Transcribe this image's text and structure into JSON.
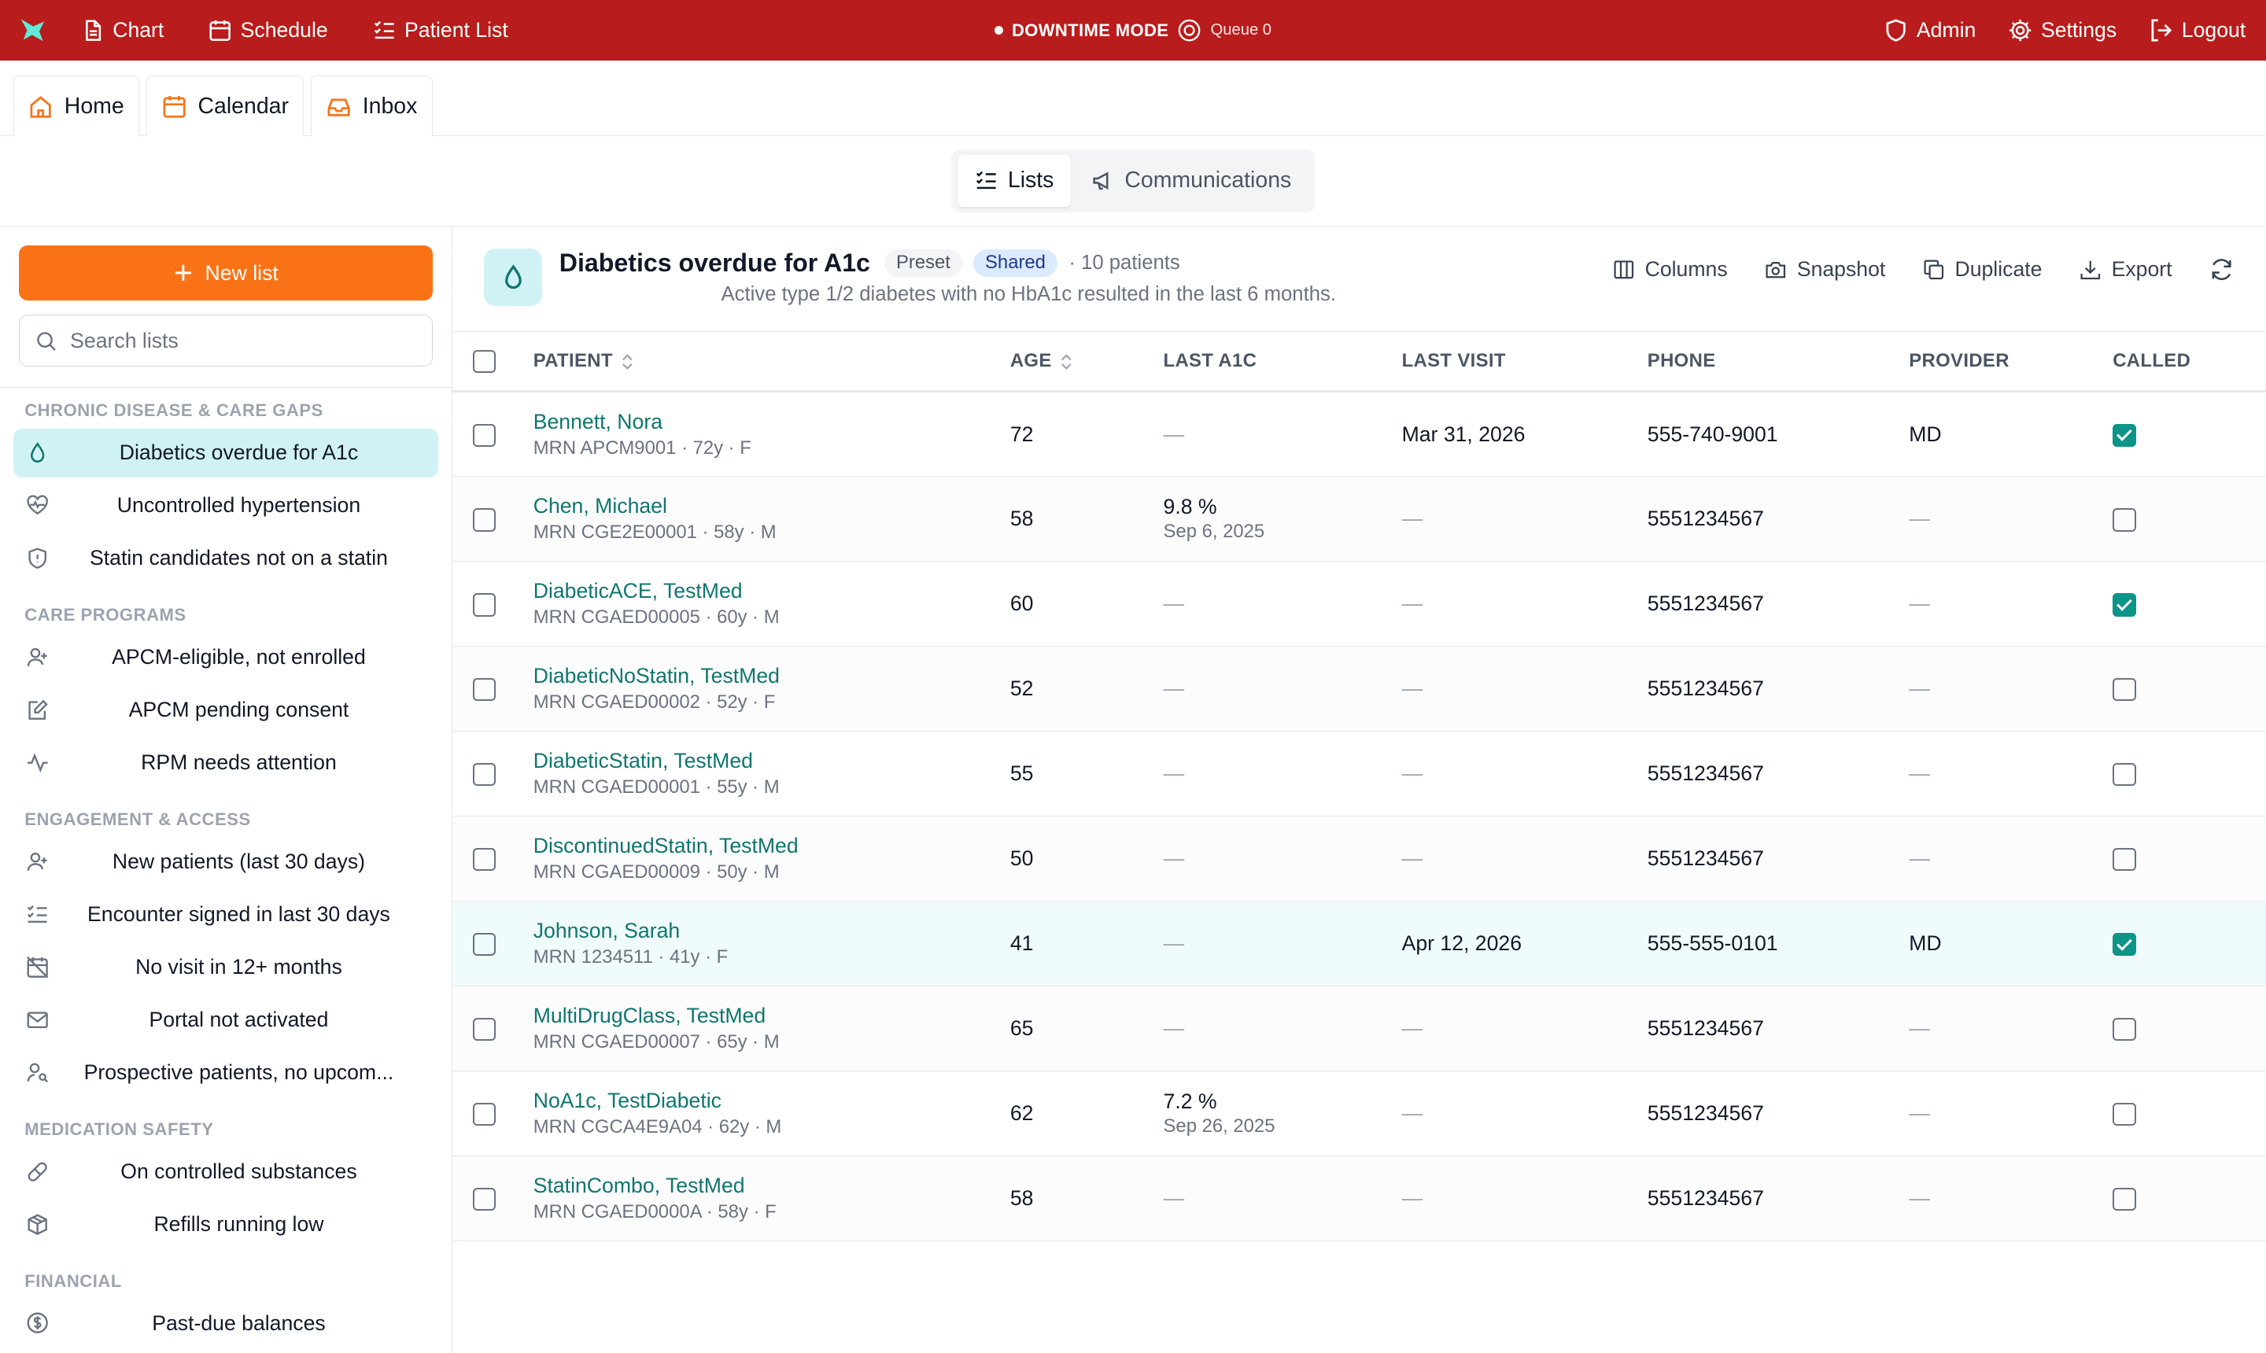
{
  "topbar": {
    "nav": [
      {
        "label": "Chart",
        "icon": "document-icon"
      },
      {
        "label": "Schedule",
        "icon": "calendar-icon"
      },
      {
        "label": "Patient List",
        "icon": "list-check-icon"
      }
    ],
    "downtime_label": "DOWNTIME MODE",
    "queue_label": "Queue 0",
    "right": [
      {
        "label": "Admin",
        "icon": "shield-icon"
      },
      {
        "label": "Settings",
        "icon": "gear-icon"
      },
      {
        "label": "Logout",
        "icon": "logout-icon"
      }
    ],
    "color": "#b91c1c"
  },
  "tabs": [
    {
      "label": "Home",
      "icon": "home-icon"
    },
    {
      "label": "Calendar",
      "icon": "calendar-icon"
    },
    {
      "label": "Inbox",
      "icon": "inbox-icon"
    }
  ],
  "segment": {
    "items": [
      {
        "label": "Lists",
        "icon": "list-check-icon",
        "active": true
      },
      {
        "label": "Communications",
        "icon": "megaphone-icon",
        "active": false
      }
    ]
  },
  "sidebar": {
    "new_list_label": "New list",
    "search_placeholder": "Search lists",
    "groups": [
      {
        "title": "CHRONIC DISEASE & CARE GAPS",
        "items": [
          {
            "label": "Diabetics overdue for A1c",
            "icon": "droplet-icon",
            "active": true
          },
          {
            "label": "Uncontrolled hypertension",
            "icon": "heart-pulse-icon"
          },
          {
            "label": "Statin candidates not on a statin",
            "icon": "shield-icon"
          }
        ]
      },
      {
        "title": "CARE PROGRAMS",
        "items": [
          {
            "label": "APCM-eligible, not enrolled",
            "icon": "user-plus-icon"
          },
          {
            "label": "APCM pending consent",
            "icon": "edit-doc-icon"
          },
          {
            "label": "RPM needs attention",
            "icon": "activity-icon"
          }
        ]
      },
      {
        "title": "ENGAGEMENT & ACCESS",
        "items": [
          {
            "label": "New patients (last 30 days)",
            "icon": "user-plus-icon"
          },
          {
            "label": "Encounter signed in last 30 days",
            "icon": "list-check-icon"
          },
          {
            "label": "No visit in 12+ months",
            "icon": "calendar-off-icon"
          },
          {
            "label": "Portal not activated",
            "icon": "mail-icon"
          },
          {
            "label": "Prospective patients, no upcom...",
            "icon": "user-search-icon"
          }
        ]
      },
      {
        "title": "MEDICATION SAFETY",
        "items": [
          {
            "label": "On controlled substances",
            "icon": "pill-icon"
          },
          {
            "label": "Refills running low",
            "icon": "package-icon"
          }
        ]
      },
      {
        "title": "FINANCIAL",
        "items": [
          {
            "label": "Past-due balances",
            "icon": "dollar-circle-icon"
          }
        ]
      }
    ]
  },
  "list": {
    "title": "Diabetics overdue for A1c",
    "chip_preset": "Preset",
    "chip_shared": "Shared",
    "count": "· 10 patients",
    "description": "Active type 1/2 diabetes with no HbA1c resulted in the last 6 months.",
    "actions": [
      {
        "label": "Columns",
        "icon": "columns-icon"
      },
      {
        "label": "Snapshot",
        "icon": "camera-icon"
      },
      {
        "label": "Duplicate",
        "icon": "copy-icon"
      },
      {
        "label": "Export",
        "icon": "download-icon"
      }
    ],
    "columns": [
      "PATIENT",
      "AGE",
      "LAST A1C",
      "LAST VISIT",
      "PHONE",
      "PROVIDER",
      "CALLED"
    ],
    "rows": [
      {
        "name": "Bennett, Nora",
        "meta": "MRN APCM9001 · 72y · F",
        "age": "72",
        "a1c": "—",
        "a1c_date": "",
        "last_visit": "Mar 31, 2026",
        "phone": "555-740-9001",
        "provider": "MD",
        "called": true
      },
      {
        "name": "Chen, Michael",
        "meta": "MRN CGE2E00001 · 58y · M",
        "age": "58",
        "a1c": "9.8 %",
        "a1c_date": "Sep 6, 2025",
        "last_visit": "—",
        "phone": "5551234567",
        "provider": "—",
        "called": false
      },
      {
        "name": "DiabeticACE, TestMed",
        "meta": "MRN CGAED00005 · 60y · M",
        "age": "60",
        "a1c": "—",
        "a1c_date": "",
        "last_visit": "—",
        "phone": "5551234567",
        "provider": "—",
        "called": true
      },
      {
        "name": "DiabeticNoStatin, TestMed",
        "meta": "MRN CGAED00002 · 52y · F",
        "age": "52",
        "a1c": "—",
        "a1c_date": "",
        "last_visit": "—",
        "phone": "5551234567",
        "provider": "—",
        "called": false
      },
      {
        "name": "DiabeticStatin, TestMed",
        "meta": "MRN CGAED00001 · 55y · M",
        "age": "55",
        "a1c": "—",
        "a1c_date": "",
        "last_visit": "—",
        "phone": "5551234567",
        "provider": "—",
        "called": false
      },
      {
        "name": "DiscontinuedStatin, TestMed",
        "meta": "MRN CGAED00009 · 50y · M",
        "age": "50",
        "a1c": "—",
        "a1c_date": "",
        "last_visit": "—",
        "phone": "5551234567",
        "provider": "—",
        "called": false
      },
      {
        "name": "Johnson, Sarah",
        "meta": "MRN 1234511 · 41y · F",
        "age": "41",
        "a1c": "—",
        "a1c_date": "",
        "last_visit": "Apr 12, 2026",
        "phone": "555-555-0101",
        "provider": "MD",
        "called": true,
        "highlight": true
      },
      {
        "name": "MultiDrugClass, TestMed",
        "meta": "MRN CGAED00007 · 65y · M",
        "age": "65",
        "a1c": "—",
        "a1c_date": "",
        "last_visit": "—",
        "phone": "5551234567",
        "provider": "—",
        "called": false
      },
      {
        "name": "NoA1c, TestDiabetic",
        "meta": "MRN CGCA4E9A04 · 62y · M",
        "age": "62",
        "a1c": "7.2 %",
        "a1c_date": "Sep 26, 2025",
        "last_visit": "—",
        "phone": "5551234567",
        "provider": "—",
        "called": false
      },
      {
        "name": "StatinCombo, TestMed",
        "meta": "MRN CGAED0000A · 58y · F",
        "age": "58",
        "a1c": "—",
        "a1c_date": "",
        "last_visit": "—",
        "phone": "5551234567",
        "provider": "—",
        "called": false
      }
    ]
  },
  "colors": {
    "accent_orange": "#f97316",
    "teal": "#0d9488",
    "link_teal": "#0f766e",
    "active_bg": "#d1f2f5"
  }
}
